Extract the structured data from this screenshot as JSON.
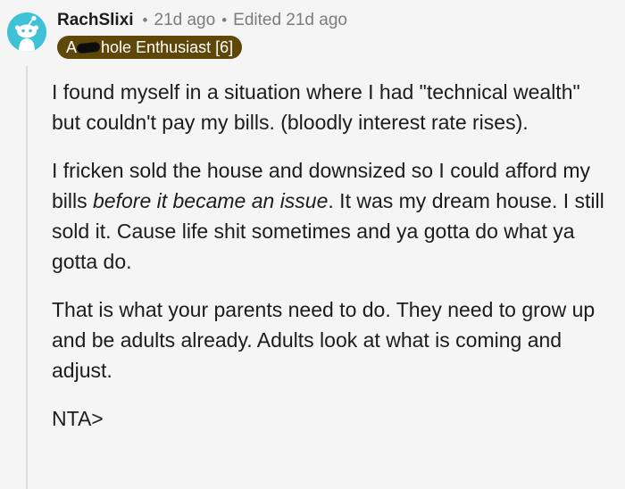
{
  "comment": {
    "username": "RachSlixi",
    "posted_time": "21d ago",
    "edited_label": "Edited 21d ago",
    "flair": {
      "prefix": "A",
      "suffix": "hole Enthusiast [6]",
      "color": "#5f4709"
    },
    "avatar": {
      "icon": "reddit-snoo-icon",
      "color": "#3fc1d8"
    },
    "paragraphs": [
      {
        "text": "I found myself in a situation where I had \"technical wealth\" but couldn't pay my bills. (bloodly interest rate rises)."
      },
      {
        "before": "I fricken sold the house and downsized so I could afford my bills ",
        "emphasis": "before it became an issue",
        "after": ". It was my dream house. I still sold it. Cause life shit sometimes and ya gotta do what ya gotta do."
      },
      {
        "text": "That is what your parents need to do. They need to grow up and be adults already. Adults look at what is coming and adjust."
      },
      {
        "text": "NTA>"
      }
    ]
  }
}
